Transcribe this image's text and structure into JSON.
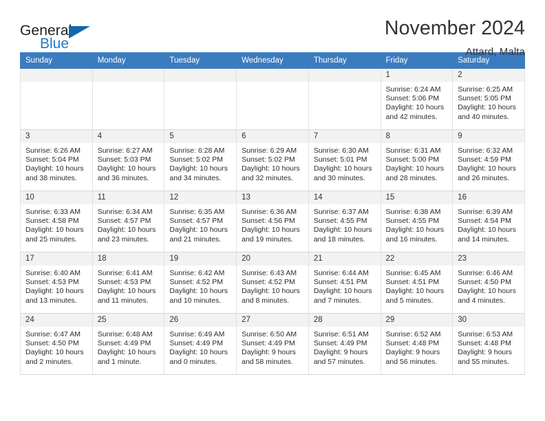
{
  "brand": {
    "name_part1": "General",
    "name_part2": "Blue",
    "triangle_color": "#1266ab",
    "blue_color": "#1f7ac4"
  },
  "header": {
    "title": "November 2024",
    "location": "Attard, Malta",
    "header_bg": "#3b7cc0"
  },
  "weekdays": [
    "Sunday",
    "Monday",
    "Tuesday",
    "Wednesday",
    "Thursday",
    "Friday",
    "Saturday"
  ],
  "weeks": [
    [
      {
        "day": "",
        "sunrise": "",
        "sunset": "",
        "daylight1": "",
        "daylight2": "",
        "empty": true
      },
      {
        "day": "",
        "sunrise": "",
        "sunset": "",
        "daylight1": "",
        "daylight2": "",
        "empty": true
      },
      {
        "day": "",
        "sunrise": "",
        "sunset": "",
        "daylight1": "",
        "daylight2": "",
        "empty": true
      },
      {
        "day": "",
        "sunrise": "",
        "sunset": "",
        "daylight1": "",
        "daylight2": "",
        "empty": true
      },
      {
        "day": "",
        "sunrise": "",
        "sunset": "",
        "daylight1": "",
        "daylight2": "",
        "empty": true
      },
      {
        "day": "1",
        "sunrise": "Sunrise: 6:24 AM",
        "sunset": "Sunset: 5:06 PM",
        "daylight1": "Daylight: 10 hours",
        "daylight2": "and 42 minutes."
      },
      {
        "day": "2",
        "sunrise": "Sunrise: 6:25 AM",
        "sunset": "Sunset: 5:05 PM",
        "daylight1": "Daylight: 10 hours",
        "daylight2": "and 40 minutes."
      }
    ],
    [
      {
        "day": "3",
        "sunrise": "Sunrise: 6:26 AM",
        "sunset": "Sunset: 5:04 PM",
        "daylight1": "Daylight: 10 hours",
        "daylight2": "and 38 minutes."
      },
      {
        "day": "4",
        "sunrise": "Sunrise: 6:27 AM",
        "sunset": "Sunset: 5:03 PM",
        "daylight1": "Daylight: 10 hours",
        "daylight2": "and 36 minutes."
      },
      {
        "day": "5",
        "sunrise": "Sunrise: 6:28 AM",
        "sunset": "Sunset: 5:02 PM",
        "daylight1": "Daylight: 10 hours",
        "daylight2": "and 34 minutes."
      },
      {
        "day": "6",
        "sunrise": "Sunrise: 6:29 AM",
        "sunset": "Sunset: 5:02 PM",
        "daylight1": "Daylight: 10 hours",
        "daylight2": "and 32 minutes."
      },
      {
        "day": "7",
        "sunrise": "Sunrise: 6:30 AM",
        "sunset": "Sunset: 5:01 PM",
        "daylight1": "Daylight: 10 hours",
        "daylight2": "and 30 minutes."
      },
      {
        "day": "8",
        "sunrise": "Sunrise: 6:31 AM",
        "sunset": "Sunset: 5:00 PM",
        "daylight1": "Daylight: 10 hours",
        "daylight2": "and 28 minutes."
      },
      {
        "day": "9",
        "sunrise": "Sunrise: 6:32 AM",
        "sunset": "Sunset: 4:59 PM",
        "daylight1": "Daylight: 10 hours",
        "daylight2": "and 26 minutes."
      }
    ],
    [
      {
        "day": "10",
        "sunrise": "Sunrise: 6:33 AM",
        "sunset": "Sunset: 4:58 PM",
        "daylight1": "Daylight: 10 hours",
        "daylight2": "and 25 minutes."
      },
      {
        "day": "11",
        "sunrise": "Sunrise: 6:34 AM",
        "sunset": "Sunset: 4:57 PM",
        "daylight1": "Daylight: 10 hours",
        "daylight2": "and 23 minutes."
      },
      {
        "day": "12",
        "sunrise": "Sunrise: 6:35 AM",
        "sunset": "Sunset: 4:57 PM",
        "daylight1": "Daylight: 10 hours",
        "daylight2": "and 21 minutes."
      },
      {
        "day": "13",
        "sunrise": "Sunrise: 6:36 AM",
        "sunset": "Sunset: 4:56 PM",
        "daylight1": "Daylight: 10 hours",
        "daylight2": "and 19 minutes."
      },
      {
        "day": "14",
        "sunrise": "Sunrise: 6:37 AM",
        "sunset": "Sunset: 4:55 PM",
        "daylight1": "Daylight: 10 hours",
        "daylight2": "and 18 minutes."
      },
      {
        "day": "15",
        "sunrise": "Sunrise: 6:38 AM",
        "sunset": "Sunset: 4:55 PM",
        "daylight1": "Daylight: 10 hours",
        "daylight2": "and 16 minutes."
      },
      {
        "day": "16",
        "sunrise": "Sunrise: 6:39 AM",
        "sunset": "Sunset: 4:54 PM",
        "daylight1": "Daylight: 10 hours",
        "daylight2": "and 14 minutes."
      }
    ],
    [
      {
        "day": "17",
        "sunrise": "Sunrise: 6:40 AM",
        "sunset": "Sunset: 4:53 PM",
        "daylight1": "Daylight: 10 hours",
        "daylight2": "and 13 minutes."
      },
      {
        "day": "18",
        "sunrise": "Sunrise: 6:41 AM",
        "sunset": "Sunset: 4:53 PM",
        "daylight1": "Daylight: 10 hours",
        "daylight2": "and 11 minutes."
      },
      {
        "day": "19",
        "sunrise": "Sunrise: 6:42 AM",
        "sunset": "Sunset: 4:52 PM",
        "daylight1": "Daylight: 10 hours",
        "daylight2": "and 10 minutes."
      },
      {
        "day": "20",
        "sunrise": "Sunrise: 6:43 AM",
        "sunset": "Sunset: 4:52 PM",
        "daylight1": "Daylight: 10 hours",
        "daylight2": "and 8 minutes."
      },
      {
        "day": "21",
        "sunrise": "Sunrise: 6:44 AM",
        "sunset": "Sunset: 4:51 PM",
        "daylight1": "Daylight: 10 hours",
        "daylight2": "and 7 minutes."
      },
      {
        "day": "22",
        "sunrise": "Sunrise: 6:45 AM",
        "sunset": "Sunset: 4:51 PM",
        "daylight1": "Daylight: 10 hours",
        "daylight2": "and 5 minutes."
      },
      {
        "day": "23",
        "sunrise": "Sunrise: 6:46 AM",
        "sunset": "Sunset: 4:50 PM",
        "daylight1": "Daylight: 10 hours",
        "daylight2": "and 4 minutes."
      }
    ],
    [
      {
        "day": "24",
        "sunrise": "Sunrise: 6:47 AM",
        "sunset": "Sunset: 4:50 PM",
        "daylight1": "Daylight: 10 hours",
        "daylight2": "and 2 minutes."
      },
      {
        "day": "25",
        "sunrise": "Sunrise: 6:48 AM",
        "sunset": "Sunset: 4:49 PM",
        "daylight1": "Daylight: 10 hours",
        "daylight2": "and 1 minute."
      },
      {
        "day": "26",
        "sunrise": "Sunrise: 6:49 AM",
        "sunset": "Sunset: 4:49 PM",
        "daylight1": "Daylight: 10 hours",
        "daylight2": "and 0 minutes."
      },
      {
        "day": "27",
        "sunrise": "Sunrise: 6:50 AM",
        "sunset": "Sunset: 4:49 PM",
        "daylight1": "Daylight: 9 hours",
        "daylight2": "and 58 minutes."
      },
      {
        "day": "28",
        "sunrise": "Sunrise: 6:51 AM",
        "sunset": "Sunset: 4:49 PM",
        "daylight1": "Daylight: 9 hours",
        "daylight2": "and 57 minutes."
      },
      {
        "day": "29",
        "sunrise": "Sunrise: 6:52 AM",
        "sunset": "Sunset: 4:48 PM",
        "daylight1": "Daylight: 9 hours",
        "daylight2": "and 56 minutes."
      },
      {
        "day": "30",
        "sunrise": "Sunrise: 6:53 AM",
        "sunset": "Sunset: 4:48 PM",
        "daylight1": "Daylight: 9 hours",
        "daylight2": "and 55 minutes."
      }
    ]
  ]
}
